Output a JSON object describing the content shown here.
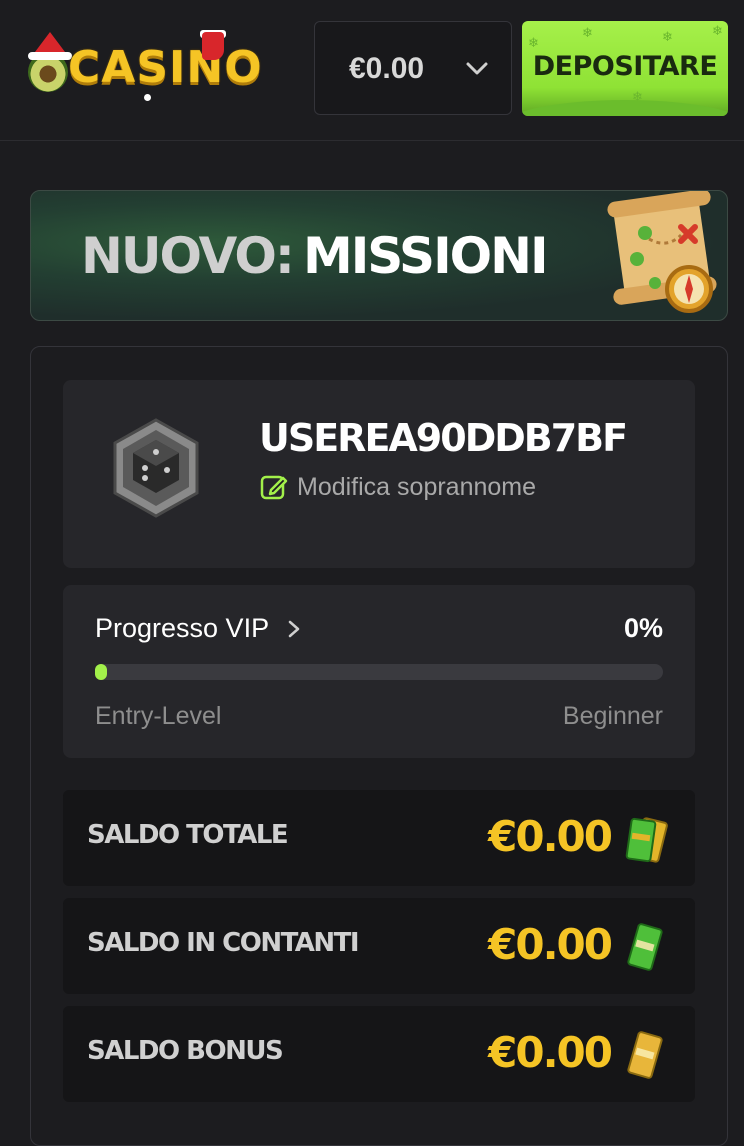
{
  "header": {
    "logo_text": "CASINO",
    "balance": "€0.00",
    "deposit_label": "DEPOSITARE"
  },
  "banner": {
    "title_prefix": "NUOVO:",
    "title_main": "MISSIONI"
  },
  "profile": {
    "username": "USEREA90DDB7BF",
    "edit_label": "Modifica soprannome"
  },
  "vip": {
    "title": "Progresso VIP",
    "percent_label": "0%",
    "progress": 0,
    "current_level": "Entry-Level",
    "next_level": "Beginner"
  },
  "balances": [
    {
      "label": "SALDO TOTALE",
      "value": "€0.00",
      "icon": "money-stack-mixed-icon"
    },
    {
      "label": "SALDO IN CONTANTI",
      "value": "€0.00",
      "icon": "cash-bill-icon"
    },
    {
      "label": "SALDO BONUS",
      "value": "€0.00",
      "icon": "bonus-bill-icon"
    }
  ],
  "colors": {
    "accent_green": "#a2f04a",
    "gold": "#f5c425",
    "background": "#1c1c1f"
  }
}
